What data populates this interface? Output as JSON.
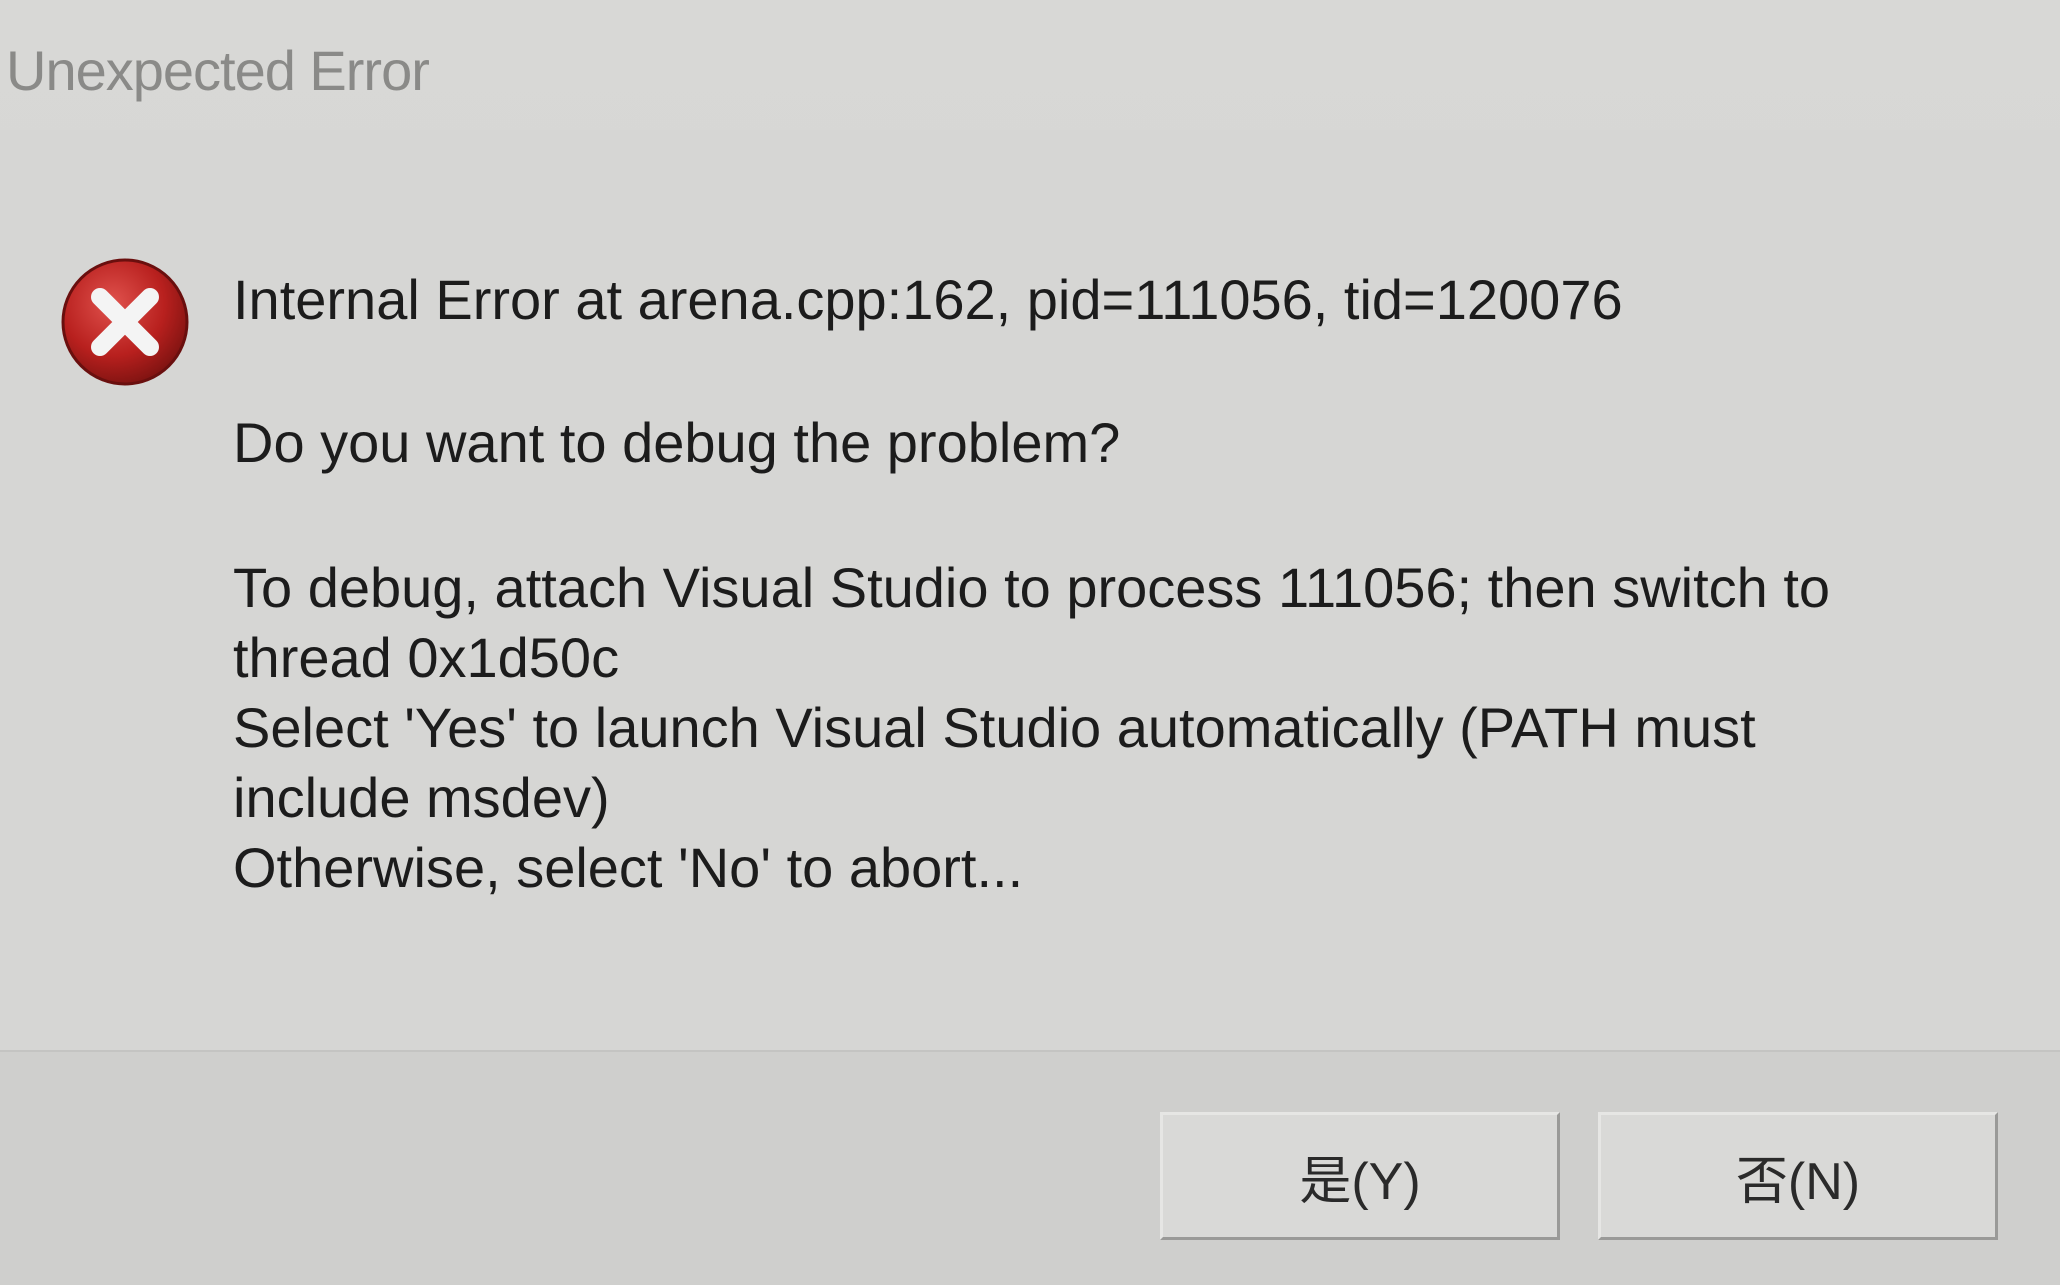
{
  "window": {
    "title": "Unexpected Error"
  },
  "message": {
    "icon": "error-x-icon",
    "headline": "Internal Error at arena.cpp:162, pid=111056, tid=120076",
    "question": "Do you want to debug the problem?",
    "lines": [
      "To debug, attach Visual Studio to process 111056; then switch to",
      "thread 0x1d50c",
      "Select 'Yes' to launch Visual Studio automatically (PATH must",
      "include msdev)",
      "Otherwise, select 'No' to abort..."
    ]
  },
  "buttons": {
    "yes_label": "是(Y)",
    "no_label": "否(N)"
  },
  "colors": {
    "dialog_bg": "#d6d6d4",
    "title_text": "#8a8a88",
    "error_red": "#b8201e",
    "text": "#1c1c1c"
  }
}
